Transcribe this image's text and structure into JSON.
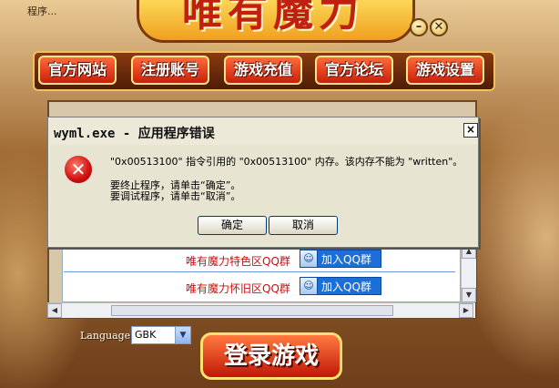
{
  "window": {
    "title_fragment": "程序...",
    "logo_text": "唯有魔力",
    "minimize_symbol": "–",
    "close_symbol": "✕"
  },
  "nav": {
    "items": [
      {
        "label": "官方网站"
      },
      {
        "label": "注册账号"
      },
      {
        "label": "游戏充值"
      },
      {
        "label": "官方论坛"
      },
      {
        "label": "游戏设置"
      }
    ]
  },
  "qq_groups": [
    {
      "name": "唯有魔力特色区QQ群",
      "button": "加入QQ群"
    },
    {
      "name": "唯有魔力怀旧区QQ群",
      "button": "加入QQ群"
    }
  ],
  "dialog": {
    "title": "wyml.exe - 应用程序错误",
    "close": "×",
    "icon": "error-icon",
    "message_line1": "\"0x00513100\" 指令引用的 \"0x00513100\" 内存。该内存不能为 \"written\"。",
    "message_line2": "要终止程序，请单击“确定”。",
    "message_line3": "要调试程序，请单击“取消”。",
    "ok_label": "确定",
    "cancel_label": "取消"
  },
  "language": {
    "label": "Language:",
    "selected": "GBK"
  },
  "login": {
    "label": "登录游戏"
  },
  "colors": {
    "nav_button": "#d8300e",
    "qq_label": "#cc1010",
    "qq_button": "#1d6fd8",
    "dialog_bg": "#ece9d8"
  }
}
